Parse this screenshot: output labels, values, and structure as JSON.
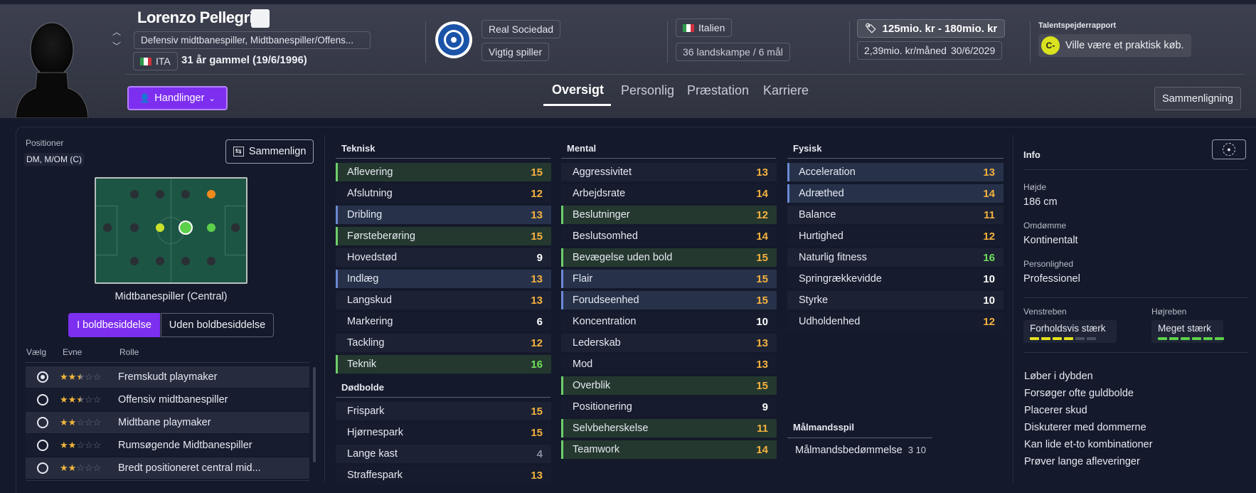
{
  "player": {
    "name": "Lorenzo Pellegrini",
    "positions_desc": "Defensiv midtbanespiller, Midtbanespiller/Offens...",
    "nationality_code": "ITA",
    "age_text": "31 år gammel (19/6/1996)",
    "actions_label": "Handlinger"
  },
  "club": {
    "name": "Real Sociedad",
    "status": "Vigtig spiller"
  },
  "nation": {
    "name": "Italien",
    "caps": "36 landskampe / 6 mål"
  },
  "contract": {
    "value": "125mio. kr - 180mio. kr",
    "wage": "2,39mio. kr/måned",
    "expires": "30/6/2029"
  },
  "scout": {
    "title": "Talentspejderrapport",
    "grade": "C-",
    "verdict": "Ville være et praktisk køb."
  },
  "tabs": [
    "Oversigt",
    "Personlig",
    "Præstation",
    "Karriere"
  ],
  "compare_label": "Sammenligning",
  "left": {
    "positions_label": "Positioner",
    "positions_value": "DM, M/OM (C)",
    "compare_btn": "Sammenlign",
    "pitch_role": "Midtbanespiller (Central)",
    "toggle_on": "I boldbesiddelse",
    "toggle_off": "Uden boldbesiddelse",
    "col_select": "Vælg",
    "col_ability": "Evne",
    "col_role": "Rolle",
    "roles": [
      {
        "name": "Fremskudt playmaker",
        "stars": 2.5,
        "selected": true
      },
      {
        "name": "Offensiv midtbanespiller",
        "stars": 2.5,
        "selected": false
      },
      {
        "name": "Midtbane playmaker",
        "stars": 2,
        "selected": false
      },
      {
        "name": "Rumsøgende Midtbanespiller",
        "stars": 2,
        "selected": false
      },
      {
        "name": "Bredt positioneret central mid...",
        "stars": 2,
        "selected": false
      }
    ]
  },
  "technical": {
    "title": "Teknisk",
    "items": [
      {
        "name": "Aflevering",
        "value": "15"
      },
      {
        "name": "Afslutning",
        "value": "12"
      },
      {
        "name": "Dribling",
        "value": "13"
      },
      {
        "name": "Førsteberøring",
        "value": "15"
      },
      {
        "name": "Hovedstød",
        "value": "9"
      },
      {
        "name": "Indlæg",
        "value": "13"
      },
      {
        "name": "Langskud",
        "value": "13"
      },
      {
        "name": "Markering",
        "value": "6"
      },
      {
        "name": "Tackling",
        "value": "12"
      },
      {
        "name": "Teknik",
        "value": "16"
      }
    ]
  },
  "setpieces": {
    "title": "Dødbolde",
    "items": [
      {
        "name": "Frispark",
        "value": "15"
      },
      {
        "name": "Hjørnespark",
        "value": "15"
      },
      {
        "name": "Lange kast",
        "value": "4"
      },
      {
        "name": "Straffespark",
        "value": "13"
      }
    ]
  },
  "mental": {
    "title": "Mental",
    "items": [
      {
        "name": "Aggressivitet",
        "value": "13"
      },
      {
        "name": "Arbejdsrate",
        "value": "14"
      },
      {
        "name": "Beslutninger",
        "value": "12"
      },
      {
        "name": "Beslutsomhed",
        "value": "14"
      },
      {
        "name": "Bevægelse uden bold",
        "value": "15"
      },
      {
        "name": "Flair",
        "value": "15"
      },
      {
        "name": "Forudseenhed",
        "value": "15"
      },
      {
        "name": "Koncentration",
        "value": "10"
      },
      {
        "name": "Lederskab",
        "value": "13"
      },
      {
        "name": "Mod",
        "value": "13"
      },
      {
        "name": "Overblik",
        "value": "15"
      },
      {
        "name": "Positionering",
        "value": "9"
      },
      {
        "name": "Selvbeherskelse",
        "value": "11"
      },
      {
        "name": "Teamwork",
        "value": "14"
      }
    ]
  },
  "physical": {
    "title": "Fysisk",
    "items": [
      {
        "name": "Acceleration",
        "value": "13"
      },
      {
        "name": "Adræthed",
        "value": "14"
      },
      {
        "name": "Balance",
        "value": "11"
      },
      {
        "name": "Hurtighed",
        "value": "12"
      },
      {
        "name": "Naturlig fitness",
        "value": "16"
      },
      {
        "name": "Springrækkevidde",
        "value": "10"
      },
      {
        "name": "Styrke",
        "value": "10"
      },
      {
        "name": "Udholdenhed",
        "value": "12"
      }
    ]
  },
  "goalkeeping": {
    "title": "Målmandsspil",
    "label": "Målmandsbedømmelse",
    "value": "3 10"
  },
  "info": {
    "title": "Info",
    "height_label": "Højde",
    "height": "186 cm",
    "reputation_label": "Omdømme",
    "reputation": "Kontinentalt",
    "personality_label": "Personlighed",
    "personality": "Professionel",
    "left_foot_label": "Venstreben",
    "left_foot": "Forholdsvis stærk",
    "left_foot_level": 4,
    "right_foot_label": "Højreben",
    "right_foot": "Meget stærk",
    "right_foot_level": 6,
    "traits": [
      "Løber i dybden",
      "Forsøger ofte guldbolde",
      "Placerer skud",
      "Diskuterer med dommerne",
      "Kan lide et-to kombinationer",
      "Prøver lange afleveringer"
    ]
  },
  "colors": {
    "accent": "#7d2ff0",
    "good": "#6ee05a",
    "mid": "#f4b23f"
  }
}
